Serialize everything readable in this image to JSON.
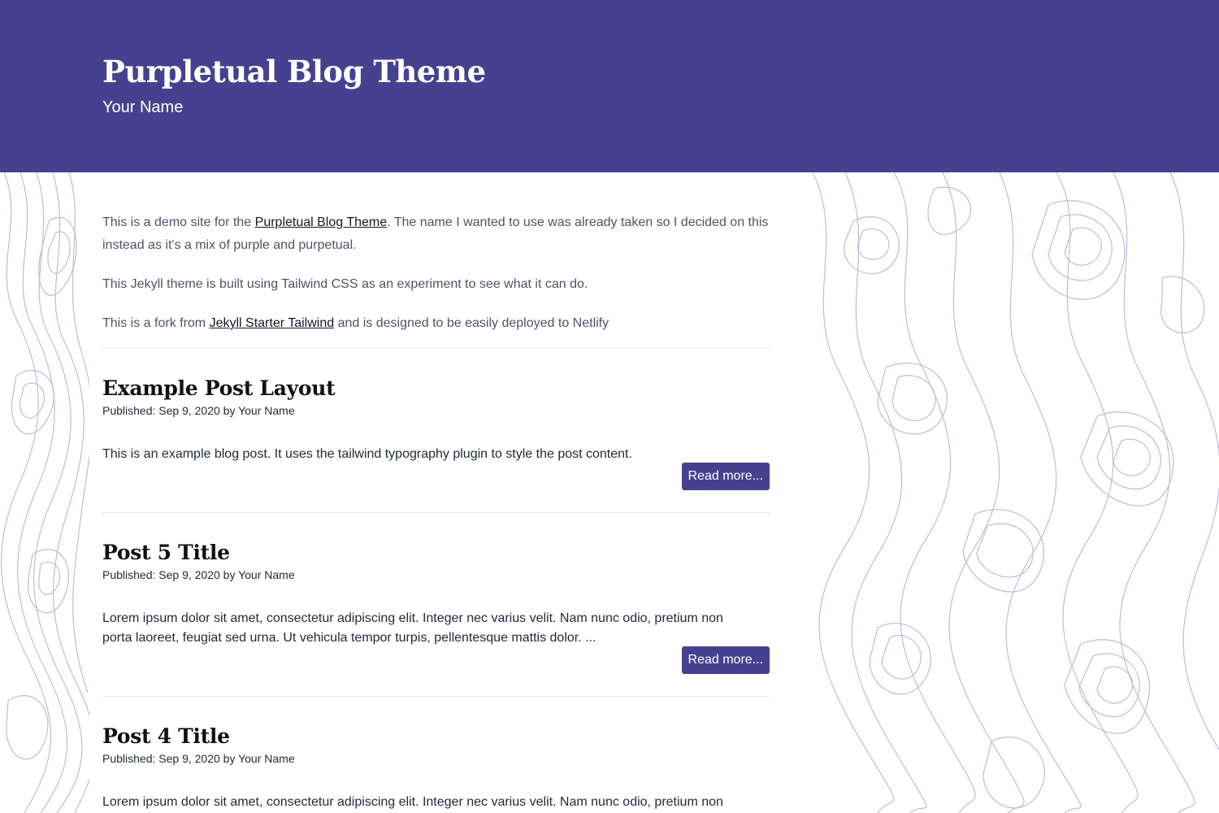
{
  "header": {
    "title": "Purpletual Blog Theme",
    "author": "Your Name",
    "background": "#46418f"
  },
  "intro": {
    "p1_before": "This is a demo site for the ",
    "p1_link": "Purpletual Blog Theme",
    "p1_after": ". The name I wanted to use was already taken so I decided on this instead as it's a mix of purple and purpetual.",
    "p2": "This Jekyll theme is built using Tailwind CSS as an experiment to see what it can do.",
    "p3_before": "This is a fork from ",
    "p3_link": "Jekyll Starter Tailwind",
    "p3_after": " and is designed to be easily deployed to Netlify"
  },
  "posts": [
    {
      "title": "Example Post Layout",
      "meta": "Published: Sep 9, 2020 by Your Name",
      "excerpt": "This is an example blog post. It uses the tailwind typography plugin to style the post content.",
      "button": "Read more..."
    },
    {
      "title": "Post 5 Title",
      "meta": "Published: Sep 9, 2020 by Your Name",
      "excerpt": "Lorem ipsum dolor sit amet, consectetur adipiscing elit. Integer nec varius velit. Nam nunc odio, pretium non porta laoreet, feugiat sed urna. Ut vehicula tempor turpis, pellentesque mattis dolor. ...",
      "button": "Read more..."
    },
    {
      "title": "Post 4 Title",
      "meta": "Published: Sep 9, 2020 by Your Name",
      "excerpt": "Lorem ipsum dolor sit amet, consectetur adipiscing elit. Integer nec varius velit. Nam nunc odio, pretium non"
    }
  ],
  "theme": {
    "accent": "#46418f",
    "contour": "#a9a4cf"
  }
}
